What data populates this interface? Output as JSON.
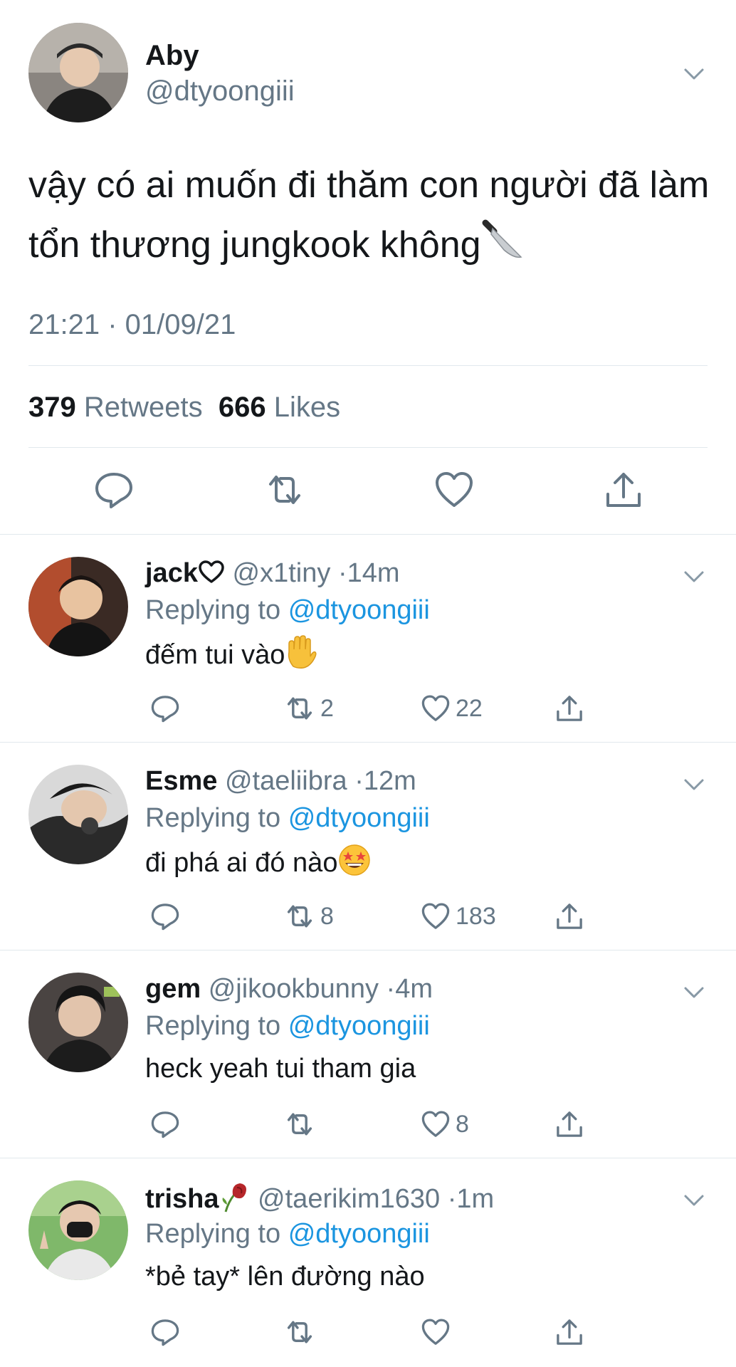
{
  "tweet": {
    "author_name": "Aby",
    "author_handle": "@dtyoongiii",
    "text": "vậy có ai muốn đi thăm con người đã làm tổn thương jungkook không",
    "text_emoji": "knife-emoji",
    "timestamp": "21:21 · 01/09/21",
    "retweets_count": "379",
    "retweets_label": "Retweets",
    "likes_count": "666",
    "likes_label": "Likes",
    "actions": [
      "reply-icon",
      "retweet-icon",
      "like-icon",
      "share-icon"
    ]
  },
  "replies": [
    {
      "name": "jack",
      "name_emoji": "heart-outline-emoji",
      "handle": "@x1tiny",
      "time": "14m",
      "replying_label": "Replying to",
      "replying_to": "@dtyoongiii",
      "text": "đếm tui vào",
      "text_emoji": "raised-hand-emoji",
      "retweets": "2",
      "likes": "22"
    },
    {
      "name": "Esme",
      "handle": "@taeliibra",
      "time": "12m",
      "replying_label": "Replying to",
      "replying_to": "@dtyoongiii",
      "text": "đi phá ai đó nào",
      "text_emoji": "star-struck-emoji",
      "retweets": "8",
      "likes": "183"
    },
    {
      "name": "gem",
      "handle": "@jikookbunny",
      "time": "4m",
      "replying_label": "Replying to",
      "replying_to": "@dtyoongiii",
      "text": "heck yeah tui tham gia",
      "retweets": "",
      "likes": "8"
    },
    {
      "name": "trisha",
      "name_emoji": "wilted-rose-emoji",
      "handle": "@taerikim1630",
      "time": "1m",
      "replying_label": "Replying to",
      "replying_to": "@dtyoongiii",
      "text": "*bẻ tay* lên đường nào",
      "retweets": "",
      "likes": ""
    }
  ],
  "colors": {
    "text_primary": "#14171a",
    "text_secondary": "#657786",
    "link": "#1b95e0",
    "divider": "#e1e8ed"
  }
}
